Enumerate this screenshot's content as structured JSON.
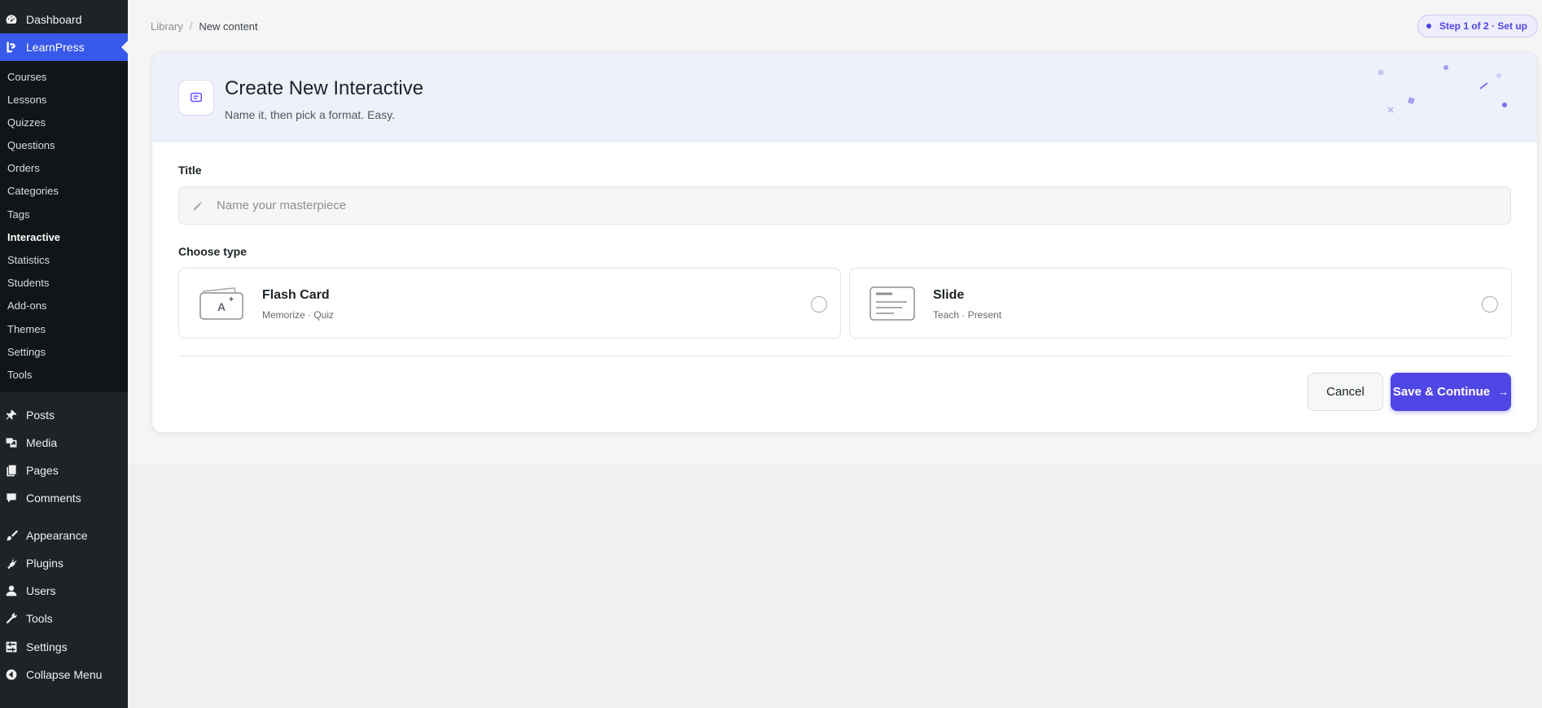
{
  "sidebar": {
    "top_items": [
      {
        "label": "Dashboard",
        "icon": "dashboard-icon"
      },
      {
        "label": "LearnPress",
        "icon": "learnpress-icon",
        "current": true
      }
    ],
    "submenu": [
      "Courses",
      "Lessons",
      "Quizzes",
      "Questions",
      "Orders",
      "Categories",
      "Tags",
      "Interactive",
      "Statistics",
      "Students",
      "Add-ons",
      "Themes",
      "Settings",
      "Tools"
    ],
    "active_submenu": "Interactive",
    "bottom_items": [
      {
        "label": "Posts",
        "icon": "pin-icon"
      },
      {
        "label": "Media",
        "icon": "media-icon"
      },
      {
        "label": "Pages",
        "icon": "pages-icon"
      },
      {
        "label": "Comments",
        "icon": "comment-icon"
      },
      {
        "label": "Appearance",
        "icon": "brush-icon"
      },
      {
        "label": "Plugins",
        "icon": "plugin-icon"
      },
      {
        "label": "Users",
        "icon": "user-icon"
      },
      {
        "label": "Tools",
        "icon": "wrench-icon"
      },
      {
        "label": "Settings",
        "icon": "settings-icon"
      },
      {
        "label": "Collapse Menu",
        "icon": "collapse-icon"
      }
    ]
  },
  "breadcrumb": {
    "parent": "Library",
    "separator": "/",
    "current": "New content"
  },
  "step_badge": "Step 1 of 2 · Set up",
  "header": {
    "title": "Create New Interactive",
    "subtitle": "Name it, then pick a format. Easy."
  },
  "form": {
    "title_label": "Title",
    "title_value": "",
    "title_placeholder": "Name your masterpiece",
    "type_label": "Choose type",
    "types": [
      {
        "name": "Flash Card",
        "desc": "Memorize · Quiz",
        "icon": "flash-card-icon",
        "selected": false
      },
      {
        "name": "Slide",
        "desc": "Teach · Present",
        "icon": "slide-icon",
        "selected": false
      }
    ]
  },
  "actions": {
    "cancel": "Cancel",
    "save": "Save & Continue"
  },
  "colors": {
    "accent": "#5046e5",
    "sidebar_bg": "#1d2327",
    "menu_current": "#3858e9",
    "header_bg": "#eef0fc"
  }
}
